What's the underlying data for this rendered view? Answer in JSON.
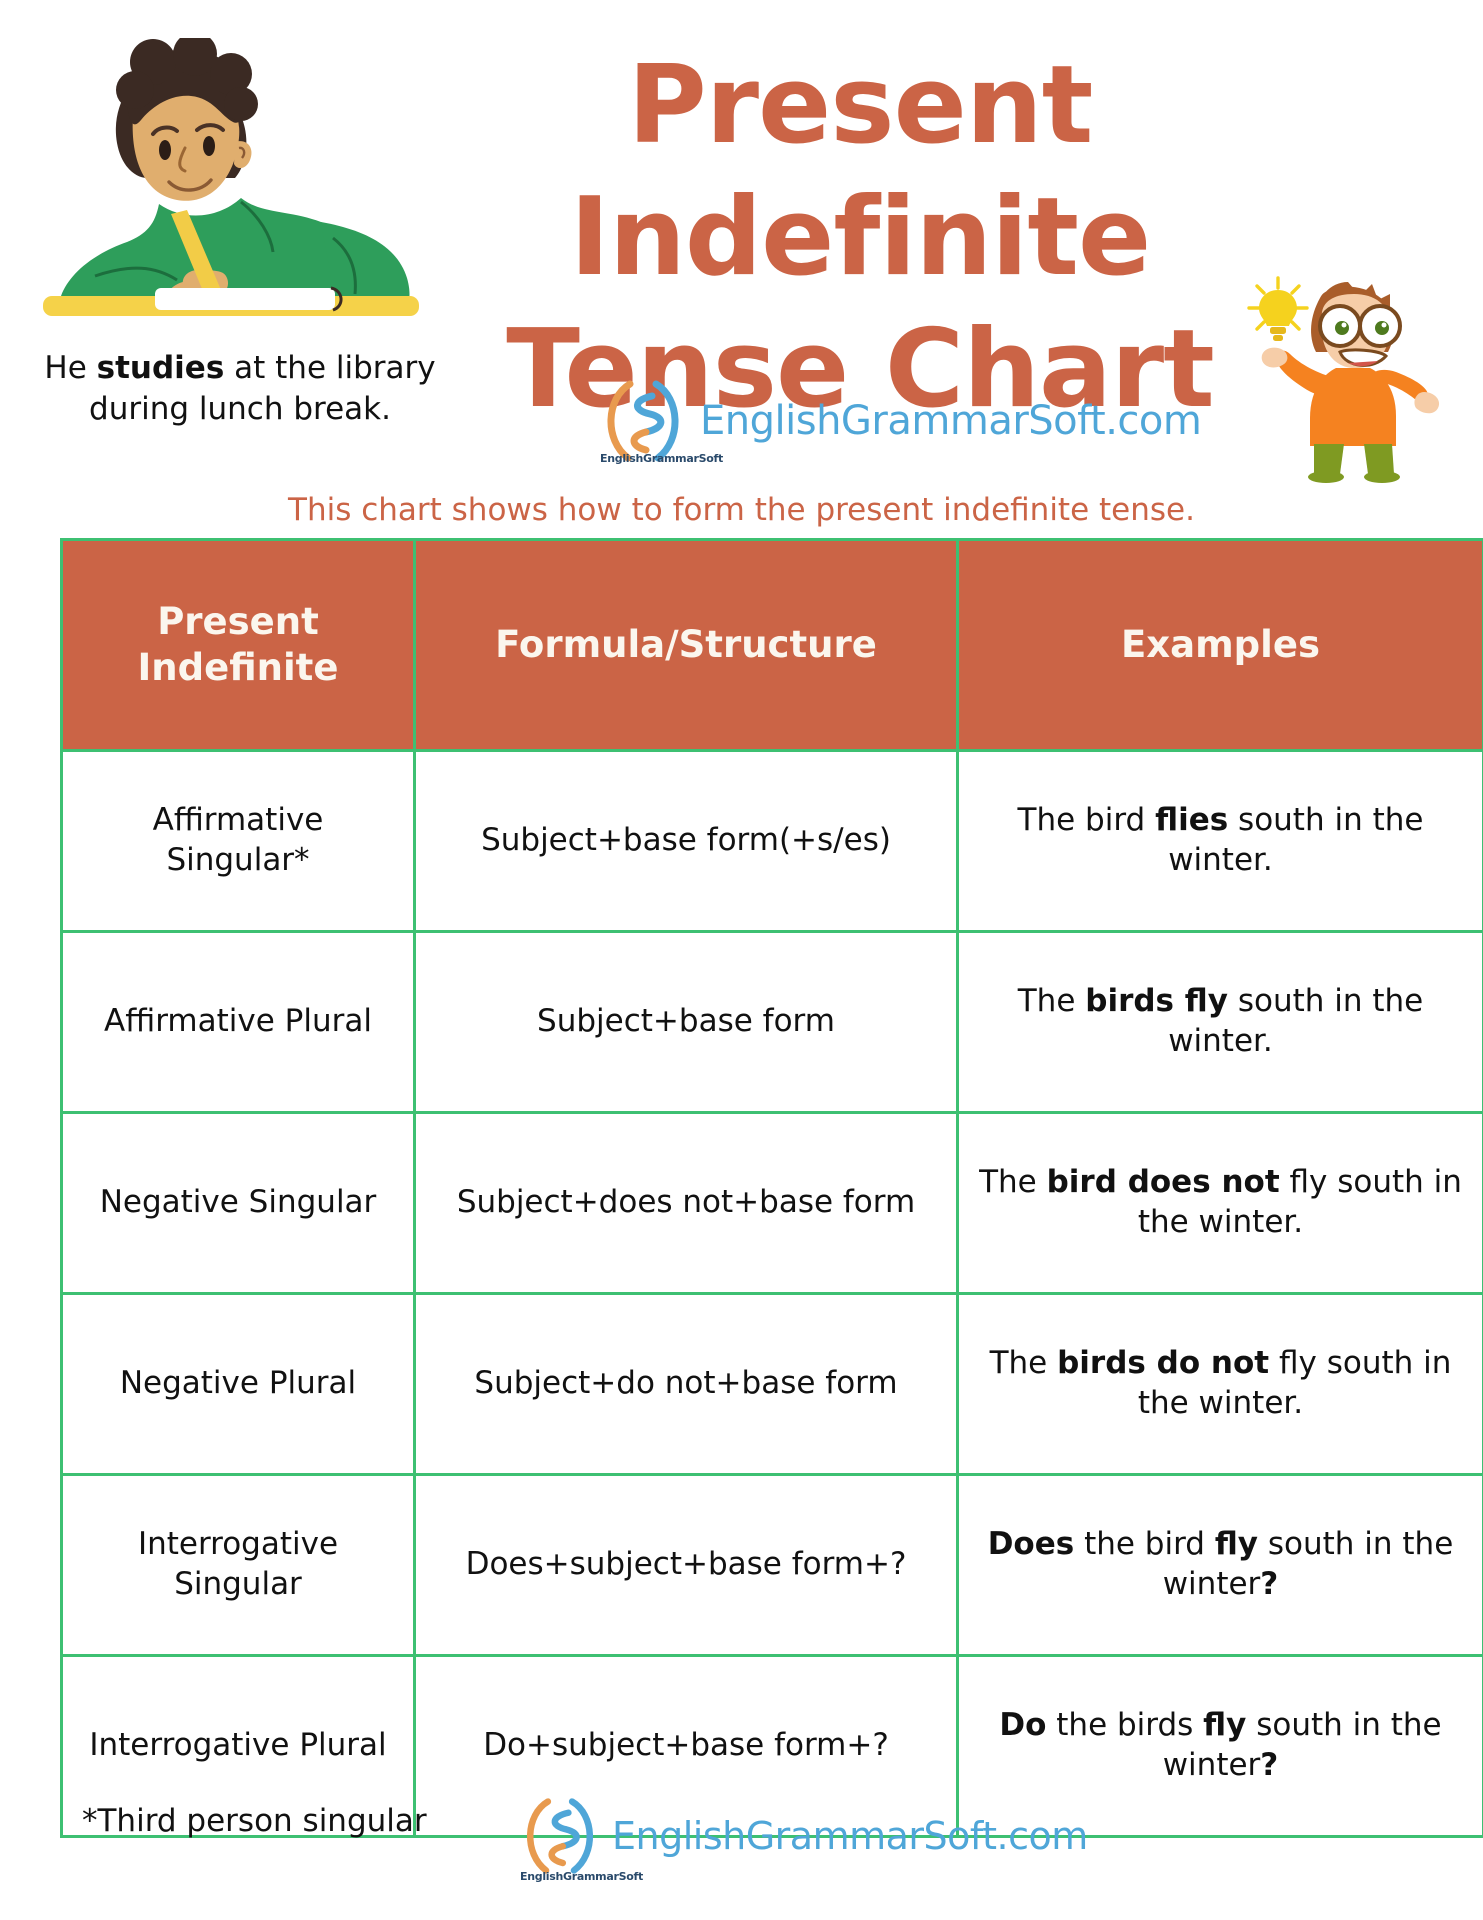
{
  "header": {
    "title_line1": "Present Indefinite",
    "title_line2": "Tense Chart",
    "caption_pre": "He ",
    "caption_bold": "studies",
    "caption_post": " at the library during lunch break.",
    "brand_text": "EnglishGrammarSoft.com",
    "brand_mark_label": "EnglishGrammarSoft",
    "subtitle": "This chart shows how to form the present indefinite tense."
  },
  "table": {
    "headers": [
      "Present Indefinite",
      "Formula/Structure",
      "Examples"
    ],
    "rows": [
      {
        "type": "Affirmative Singular*",
        "formula": "Subject+base form(+s/es)",
        "example_parts": [
          {
            "text": "The bird ",
            "bold": false
          },
          {
            "text": "flies",
            "bold": true
          },
          {
            "text": " south in the winter.",
            "bold": false
          }
        ]
      },
      {
        "type": "Affirmative Plural",
        "formula": "Subject+base form",
        "example_parts": [
          {
            "text": "The ",
            "bold": false
          },
          {
            "text": "birds fly",
            "bold": true
          },
          {
            "text": " south in the winter.",
            "bold": false
          }
        ]
      },
      {
        "type": "Negative Singular",
        "formula": "Subject+does not+base form",
        "example_parts": [
          {
            "text": "The ",
            "bold": false
          },
          {
            "text": "bird does not",
            "bold": true
          },
          {
            "text": " fly south in the winter.",
            "bold": false
          }
        ]
      },
      {
        "type": "Negative Plural",
        "formula": "Subject+do not+base form",
        "example_parts": [
          {
            "text": "The ",
            "bold": false
          },
          {
            "text": "birds do not",
            "bold": true
          },
          {
            "text": " fly south in the winter.",
            "bold": false
          }
        ]
      },
      {
        "type": "Interrogative Singular",
        "formula": "Does+subject+base form+?",
        "example_parts": [
          {
            "text": "Does",
            "bold": true
          },
          {
            "text": " the bird ",
            "bold": false
          },
          {
            "text": "fly",
            "bold": true
          },
          {
            "text": " south in the winter",
            "bold": false
          },
          {
            "text": "?",
            "bold": true
          }
        ]
      },
      {
        "type": "Interrogative Plural",
        "formula": "Do+subject+base form+?",
        "example_parts": [
          {
            "text": "Do",
            "bold": true
          },
          {
            "text": " the birds ",
            "bold": false
          },
          {
            "text": "fly",
            "bold": true
          },
          {
            "text": " south in the winter",
            "bold": false
          },
          {
            "text": "?",
            "bold": true
          }
        ]
      }
    ]
  },
  "footer": {
    "footnote": "*Third person singular",
    "brand_text": "EnglishGrammarSoft.com",
    "brand_mark_label": "EnglishGrammarSoft"
  },
  "colors": {
    "accent_orange": "#CB6446",
    "table_border_green": "#3DC072",
    "header_text": "#FBF6EE",
    "brand_blue": "#4FA6D8",
    "brand_orange": "#E89A4E",
    "shirt_green": "#2E9E5B",
    "desk_yellow": "#F5D249",
    "idea_orange": "#F58220",
    "bulb_yellow": "#F5D21E"
  }
}
